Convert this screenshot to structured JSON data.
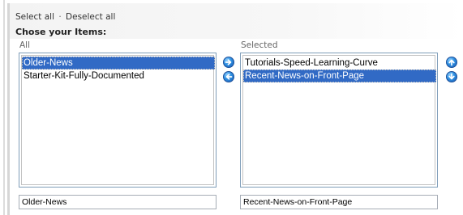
{
  "links": {
    "select_all": "Select all",
    "separator": "·",
    "deselect_all": "Deselect all"
  },
  "heading": "Chose your Items:",
  "all_list": {
    "label": "All",
    "items": [
      "Older-News",
      "Starter-Kit-Fully-Documented"
    ],
    "selected_index": 0,
    "field_value": "Older-News"
  },
  "selected_list": {
    "label": "Selected",
    "items": [
      "Tutorials-Speed-Learning-Curve",
      "Recent-News-on-Front-Page"
    ],
    "selected_index": 1,
    "field_value": "Recent-News-on-Front-Page"
  },
  "colors": {
    "selection": "#316ac5",
    "button": "#2f8fe0"
  },
  "icons": [
    "move-right-icon",
    "move-left-icon",
    "move-up-icon",
    "move-down-icon"
  ]
}
